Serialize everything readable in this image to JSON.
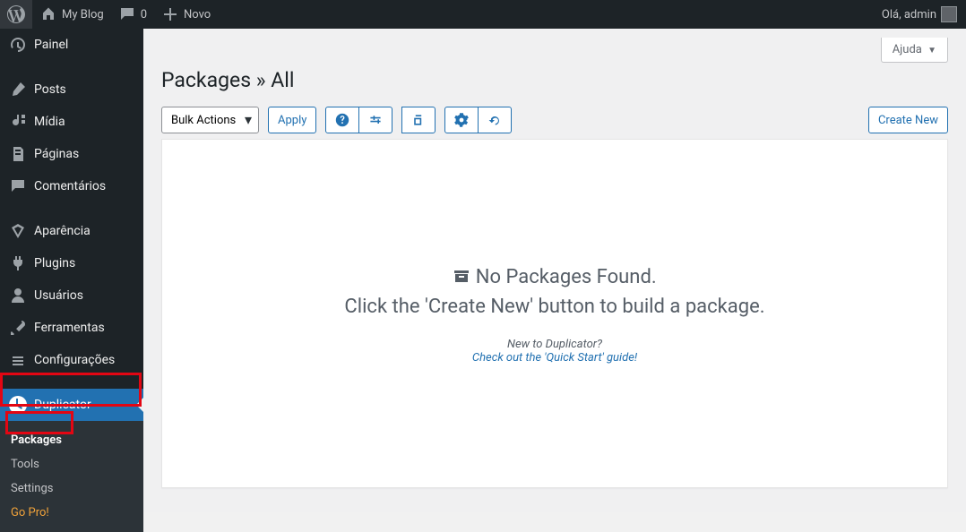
{
  "toolbar": {
    "site_name": "My Blog",
    "comments_count": "0",
    "new_label": "Novo",
    "greeting": "Olá, admin"
  },
  "sidebar": {
    "items": [
      {
        "label": "Painel"
      },
      {
        "label": "Posts"
      },
      {
        "label": "Mídia"
      },
      {
        "label": "Páginas"
      },
      {
        "label": "Comentários"
      },
      {
        "label": "Aparência"
      },
      {
        "label": "Plugins"
      },
      {
        "label": "Usuários"
      },
      {
        "label": "Ferramentas"
      },
      {
        "label": "Configurações"
      },
      {
        "label": "Duplicator"
      }
    ],
    "submenu": [
      {
        "label": "Packages"
      },
      {
        "label": "Tools"
      },
      {
        "label": "Settings"
      },
      {
        "label": "Go Pro!"
      }
    ]
  },
  "content": {
    "help_label": "Ajuda",
    "page_title": "Packages » All",
    "bulk_default": "Bulk Actions",
    "apply_label": "Apply",
    "create_label": "Create New",
    "empty_heading": "No Packages Found.",
    "empty_sub": "Click the 'Create New' button to build a package.",
    "new_to": "New to Duplicator?",
    "quick_start": "Check out the 'Quick Start' guide!"
  }
}
